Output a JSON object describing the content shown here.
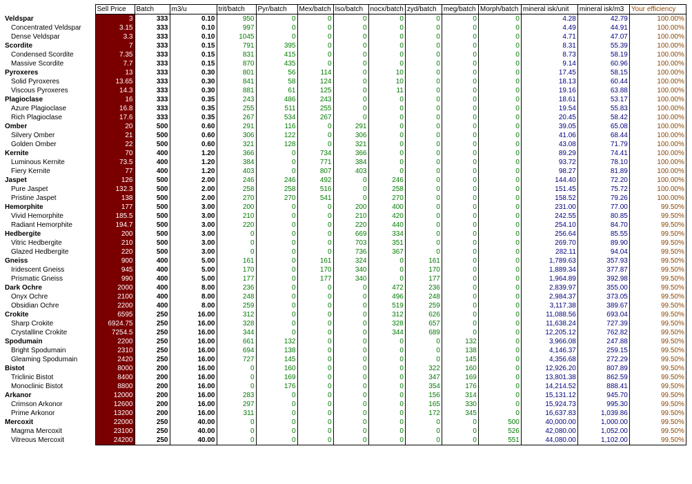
{
  "columns": [
    "",
    "Sell Price",
    "Batch",
    "m3/u",
    "trit/batch",
    "Pyr/batch",
    "Mex/batch",
    "Iso/batch",
    "nocx/batch",
    "zyd/batch",
    "meg/batch",
    "Morph/batch",
    "mineral isk/unit",
    "mineral isk/m3",
    "Your efficiency"
  ],
  "rows": [
    {
      "name": "Veldspar",
      "parent": true,
      "cells": [
        "3",
        "333",
        "0.10",
        "950",
        "0",
        "0",
        "0",
        "0",
        "0",
        "0",
        "0",
        "4.28",
        "42.79",
        "100.00%"
      ]
    },
    {
      "name": "Concentrated Veldspar",
      "parent": false,
      "cells": [
        "3.15",
        "333",
        "0.10",
        "997",
        "0",
        "0",
        "0",
        "0",
        "0",
        "0",
        "0",
        "4.49",
        "44.91",
        "100.00%"
      ]
    },
    {
      "name": "Dense Veldspar",
      "parent": false,
      "cells": [
        "3.3",
        "333",
        "0.10",
        "1045",
        "0",
        "0",
        "0",
        "0",
        "0",
        "0",
        "0",
        "4.71",
        "47.07",
        "100.00%"
      ]
    },
    {
      "name": "Scordite",
      "parent": true,
      "cells": [
        "7",
        "333",
        "0.15",
        "791",
        "395",
        "0",
        "0",
        "0",
        "0",
        "0",
        "0",
        "8.31",
        "55.39",
        "100.00%"
      ]
    },
    {
      "name": "Condensed Scordite",
      "parent": false,
      "cells": [
        "7.35",
        "333",
        "0.15",
        "831",
        "415",
        "0",
        "0",
        "0",
        "0",
        "0",
        "0",
        "8.73",
        "58.19",
        "100.00%"
      ]
    },
    {
      "name": "Massive Scordite",
      "parent": false,
      "cells": [
        "7.7",
        "333",
        "0.15",
        "870",
        "435",
        "0",
        "0",
        "0",
        "0",
        "0",
        "0",
        "9.14",
        "60.96",
        "100.00%"
      ]
    },
    {
      "name": "Pyroxeres",
      "parent": true,
      "cells": [
        "13",
        "333",
        "0.30",
        "801",
        "56",
        "114",
        "0",
        "10",
        "0",
        "0",
        "0",
        "17.45",
        "58.15",
        "100.00%"
      ]
    },
    {
      "name": "Solid Pyroxeres",
      "parent": false,
      "cells": [
        "13.65",
        "333",
        "0.30",
        "841",
        "58",
        "124",
        "0",
        "10",
        "0",
        "0",
        "0",
        "18.13",
        "60.44",
        "100.00%"
      ]
    },
    {
      "name": "Viscous Pyroxeres",
      "parent": false,
      "cells": [
        "14.3",
        "333",
        "0.30",
        "881",
        "61",
        "125",
        "0",
        "11",
        "0",
        "0",
        "0",
        "19.16",
        "63.88",
        "100.00%"
      ]
    },
    {
      "name": "Plagioclase",
      "parent": true,
      "cells": [
        "16",
        "333",
        "0.35",
        "243",
        "486",
        "243",
        "0",
        "0",
        "0",
        "0",
        "0",
        "18.61",
        "53.17",
        "100.00%"
      ]
    },
    {
      "name": "Azure Plagioclase",
      "parent": false,
      "cells": [
        "16.8",
        "333",
        "0.35",
        "255",
        "511",
        "255",
        "0",
        "0",
        "0",
        "0",
        "0",
        "19.54",
        "55.83",
        "100.00%"
      ]
    },
    {
      "name": "Rich Plagioclase",
      "parent": false,
      "cells": [
        "17.6",
        "333",
        "0.35",
        "267",
        "534",
        "267",
        "0",
        "0",
        "0",
        "0",
        "0",
        "20.45",
        "58.42",
        "100.00%"
      ]
    },
    {
      "name": "Omber",
      "parent": true,
      "cells": [
        "20",
        "500",
        "0.60",
        "291",
        "116",
        "0",
        "291",
        "0",
        "0",
        "0",
        "0",
        "39.05",
        "65.08",
        "100.00%"
      ]
    },
    {
      "name": "Silvery Omber",
      "parent": false,
      "cells": [
        "21",
        "500",
        "0.60",
        "306",
        "122",
        "0",
        "306",
        "0",
        "0",
        "0",
        "0",
        "41.06",
        "68.44",
        "100.00%"
      ]
    },
    {
      "name": "Golden Omber",
      "parent": false,
      "cells": [
        "22",
        "500",
        "0.60",
        "321",
        "128",
        "0",
        "321",
        "0",
        "0",
        "0",
        "0",
        "43.08",
        "71.79",
        "100.00%"
      ]
    },
    {
      "name": "Kernite",
      "parent": true,
      "cells": [
        "70",
        "400",
        "1.20",
        "366",
        "0",
        "734",
        "366",
        "0",
        "0",
        "0",
        "0",
        "89.29",
        "74.41",
        "100.00%"
      ]
    },
    {
      "name": "Luminous Kernite",
      "parent": false,
      "cells": [
        "73.5",
        "400",
        "1.20",
        "384",
        "0",
        "771",
        "384",
        "0",
        "0",
        "0",
        "0",
        "93.72",
        "78.10",
        "100.00%"
      ]
    },
    {
      "name": "Fiery Kernite",
      "parent": false,
      "cells": [
        "77",
        "400",
        "1.20",
        "403",
        "0",
        "807",
        "403",
        "0",
        "0",
        "0",
        "0",
        "98.27",
        "81.89",
        "100.00%"
      ]
    },
    {
      "name": "Jaspet",
      "parent": true,
      "cells": [
        "126",
        "500",
        "2.00",
        "246",
        "246",
        "492",
        "0",
        "246",
        "0",
        "0",
        "0",
        "144.40",
        "72.20",
        "100.00%"
      ]
    },
    {
      "name": "Pure Jaspet",
      "parent": false,
      "cells": [
        "132.3",
        "500",
        "2.00",
        "258",
        "258",
        "516",
        "0",
        "258",
        "0",
        "0",
        "0",
        "151.45",
        "75.72",
        "100.00%"
      ]
    },
    {
      "name": "Pristine Jaspet",
      "parent": false,
      "cells": [
        "138",
        "500",
        "2.00",
        "270",
        "270",
        "541",
        "0",
        "270",
        "0",
        "0",
        "0",
        "158.52",
        "79.26",
        "100.00%"
      ]
    },
    {
      "name": "Hemorphite",
      "parent": true,
      "cells": [
        "177",
        "500",
        "3.00",
        "200",
        "0",
        "0",
        "200",
        "400",
        "0",
        "0",
        "0",
        "231.00",
        "77.00",
        "99.50%"
      ]
    },
    {
      "name": "Vivid Hemorphite",
      "parent": false,
      "cells": [
        "185.5",
        "500",
        "3.00",
        "210",
        "0",
        "0",
        "210",
        "420",
        "0",
        "0",
        "0",
        "242.55",
        "80.85",
        "99.50%"
      ]
    },
    {
      "name": "Radiant Hemorphite",
      "parent": false,
      "cells": [
        "194.7",
        "500",
        "3.00",
        "220",
        "0",
        "0",
        "220",
        "440",
        "0",
        "0",
        "0",
        "254.10",
        "84.70",
        "99.50%"
      ]
    },
    {
      "name": "Hedbergite",
      "parent": true,
      "cells": [
        "200",
        "500",
        "3.00",
        "0",
        "0",
        "0",
        "669",
        "334",
        "0",
        "0",
        "0",
        "256.64",
        "85.55",
        "99.50%"
      ]
    },
    {
      "name": "Vitric Hedbergite",
      "parent": false,
      "cells": [
        "210",
        "500",
        "3.00",
        "0",
        "0",
        "0",
        "703",
        "351",
        "0",
        "0",
        "0",
        "269.70",
        "89.90",
        "99.50%"
      ]
    },
    {
      "name": "Glazed Hedbergite",
      "parent": false,
      "cells": [
        "220",
        "500",
        "3.00",
        "0",
        "0",
        "0",
        "736",
        "367",
        "0",
        "0",
        "0",
        "282.11",
        "94.04",
        "99.50%"
      ]
    },
    {
      "name": "Gneiss",
      "parent": true,
      "cells": [
        "900",
        "400",
        "5.00",
        "161",
        "0",
        "161",
        "324",
        "0",
        "161",
        "0",
        "0",
        "1,789.63",
        "357.93",
        "99.50%"
      ]
    },
    {
      "name": "Iridescent Gneiss",
      "parent": false,
      "cells": [
        "945",
        "400",
        "5.00",
        "170",
        "0",
        "170",
        "340",
        "0",
        "170",
        "0",
        "0",
        "1,889.34",
        "377.87",
        "99.50%"
      ]
    },
    {
      "name": "Prismatic Gneiss",
      "parent": false,
      "cells": [
        "990",
        "400",
        "5.00",
        "177",
        "0",
        "177",
        "340",
        "0",
        "177",
        "0",
        "0",
        "1,964.89",
        "392.98",
        "99.50%"
      ]
    },
    {
      "name": "Dark Ochre",
      "parent": true,
      "cells": [
        "2000",
        "400",
        "8.00",
        "236",
        "0",
        "0",
        "0",
        "472",
        "236",
        "0",
        "0",
        "2,839.97",
        "355.00",
        "99.50%"
      ]
    },
    {
      "name": "Onyx Ochre",
      "parent": false,
      "cells": [
        "2100",
        "400",
        "8.00",
        "248",
        "0",
        "0",
        "0",
        "496",
        "248",
        "0",
        "0",
        "2,984.37",
        "373.05",
        "99.50%"
      ]
    },
    {
      "name": "Obsidian Ochre",
      "parent": false,
      "cells": [
        "2200",
        "400",
        "8.00",
        "259",
        "0",
        "0",
        "0",
        "519",
        "259",
        "0",
        "0",
        "3,117.38",
        "389.67",
        "99.50%"
      ]
    },
    {
      "name": "Crokite",
      "parent": true,
      "cells": [
        "6595",
        "250",
        "16.00",
        "312",
        "0",
        "0",
        "0",
        "312",
        "626",
        "0",
        "0",
        "11,088.56",
        "693.04",
        "99.50%"
      ]
    },
    {
      "name": "Sharp Crokite",
      "parent": false,
      "cells": [
        "6924.75",
        "250",
        "16.00",
        "328",
        "0",
        "0",
        "0",
        "328",
        "657",
        "0",
        "0",
        "11,638.24",
        "727.39",
        "99.50%"
      ]
    },
    {
      "name": "Crystalline Crokite",
      "parent": false,
      "cells": [
        "7254.5",
        "250",
        "16.00",
        "344",
        "0",
        "0",
        "0",
        "344",
        "689",
        "0",
        "0",
        "12,205.12",
        "762.82",
        "99.50%"
      ]
    },
    {
      "name": "Spodumain",
      "parent": true,
      "cells": [
        "2200",
        "250",
        "16.00",
        "661",
        "132",
        "0",
        "0",
        "0",
        "0",
        "132",
        "0",
        "3,966.08",
        "247.88",
        "99.50%"
      ]
    },
    {
      "name": "Bright Spodumain",
      "parent": false,
      "cells": [
        "2310",
        "250",
        "16.00",
        "694",
        "138",
        "0",
        "0",
        "0",
        "0",
        "138",
        "0",
        "4,146.37",
        "259.15",
        "99.50%"
      ]
    },
    {
      "name": "Gleaming Spodumain",
      "parent": false,
      "cells": [
        "2420",
        "250",
        "16.00",
        "727",
        "145",
        "0",
        "0",
        "0",
        "0",
        "145",
        "0",
        "4,356.68",
        "272.29",
        "99.50%"
      ]
    },
    {
      "name": "Bistot",
      "parent": true,
      "cells": [
        "8000",
        "200",
        "16.00",
        "0",
        "160",
        "0",
        "0",
        "0",
        "322",
        "160",
        "0",
        "12,926.20",
        "807.89",
        "99.50%"
      ]
    },
    {
      "name": "Triclinic Bistot",
      "parent": false,
      "cells": [
        "8400",
        "200",
        "16.00",
        "0",
        "169",
        "0",
        "0",
        "0",
        "347",
        "169",
        "0",
        "13,801.38",
        "862.59",
        "99.50%"
      ]
    },
    {
      "name": "Monoclinic Bistot",
      "parent": false,
      "cells": [
        "8800",
        "200",
        "16.00",
        "0",
        "176",
        "0",
        "0",
        "0",
        "354",
        "176",
        "0",
        "14,214.52",
        "888.41",
        "99.50%"
      ]
    },
    {
      "name": "Arkanor",
      "parent": true,
      "cells": [
        "12000",
        "200",
        "16.00",
        "283",
        "0",
        "0",
        "0",
        "0",
        "156",
        "314",
        "0",
        "15,131.12",
        "945.70",
        "99.50%"
      ]
    },
    {
      "name": "Crimson Arkonor",
      "parent": false,
      "cells": [
        "12600",
        "200",
        "16.00",
        "297",
        "0",
        "0",
        "0",
        "0",
        "165",
        "330",
        "0",
        "15,924.73",
        "995.30",
        "99.50%"
      ]
    },
    {
      "name": "Prime Arkonor",
      "parent": false,
      "cells": [
        "13200",
        "200",
        "16.00",
        "311",
        "0",
        "0",
        "0",
        "0",
        "172",
        "345",
        "0",
        "16,637.83",
        "1,039.86",
        "99.50%"
      ]
    },
    {
      "name": "Mercoxit",
      "parent": true,
      "cells": [
        "22000",
        "250",
        "40.00",
        "0",
        "0",
        "0",
        "0",
        "0",
        "0",
        "0",
        "500",
        "40,000.00",
        "1,000.00",
        "99.50%"
      ]
    },
    {
      "name": "Magma Mercoxit",
      "parent": false,
      "cells": [
        "23100",
        "250",
        "40.00",
        "0",
        "0",
        "0",
        "0",
        "0",
        "0",
        "0",
        "526",
        "42,080.00",
        "1,052.00",
        "99.50%"
      ]
    },
    {
      "name": "Vitreous Mercoxit",
      "parent": false,
      "cells": [
        "24200",
        "250",
        "40.00",
        "0",
        "0",
        "0",
        "0",
        "0",
        "0",
        "0",
        "551",
        "44,080.00",
        "1,102.00",
        "99.50%"
      ]
    }
  ],
  "colors": {
    "price_bg": "#7a0000",
    "mineral_text": "#007a00",
    "isk_text": "#00007f",
    "efficiency_text": "#8b4500"
  }
}
